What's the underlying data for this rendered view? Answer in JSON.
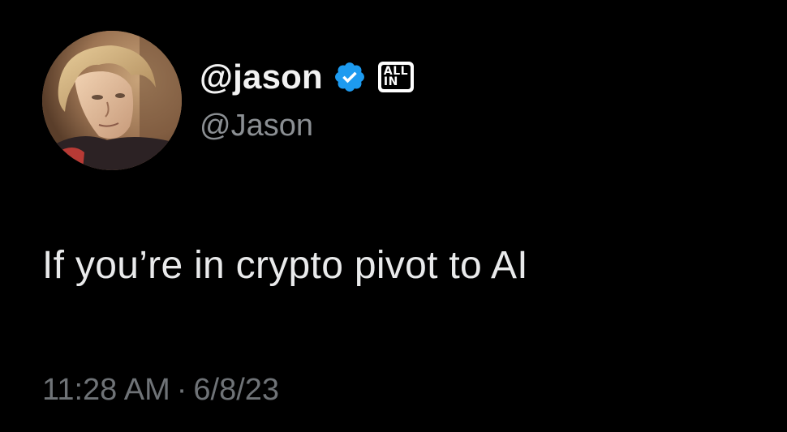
{
  "author": {
    "display_name": "@jason",
    "handle": "@Jason",
    "verified_icon": "verified-check-icon",
    "affiliate_badge": {
      "line1": "ALL",
      "line2": "IN"
    }
  },
  "tweet": {
    "text": "If you’re in crypto pivot to AI",
    "time": "11:28 AM",
    "separator": "·",
    "date": "6/8/23"
  },
  "colors": {
    "background": "#000000",
    "text_primary": "#e9eaeb",
    "text_secondary": "#8b8f93",
    "verified_blue": "#1d9bf0"
  }
}
